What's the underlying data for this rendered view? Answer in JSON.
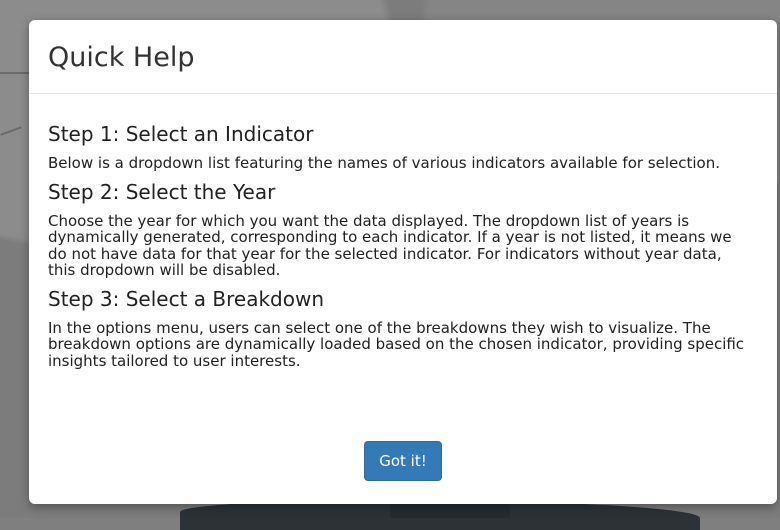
{
  "modal": {
    "title": "Quick Help",
    "steps": [
      {
        "title": "Step 1: Select an Indicator",
        "text": "Below is a dropdown list featuring the names of various indicators available for selection."
      },
      {
        "title": "Step 2: Select the Year",
        "text": "Choose the year for which you want the data displayed. The dropdown list of years is dynamically generated, corresponding to each indicator. If a year is not listed, it means we do not have data for that year for the selected indicator. For indicators without year data, this dropdown will be disabled."
      },
      {
        "title": "Step 3: Select a Breakdown",
        "text": "In the options menu, users can select one of the breakdowns they wish to visualize. The breakdown options are dynamically loaded based on the chosen indicator, providing specific insights tailored to user interests."
      }
    ],
    "button_label": "Got it!"
  },
  "colors": {
    "primary_button": "#337ab7",
    "backdrop": "#7f7f7f"
  }
}
